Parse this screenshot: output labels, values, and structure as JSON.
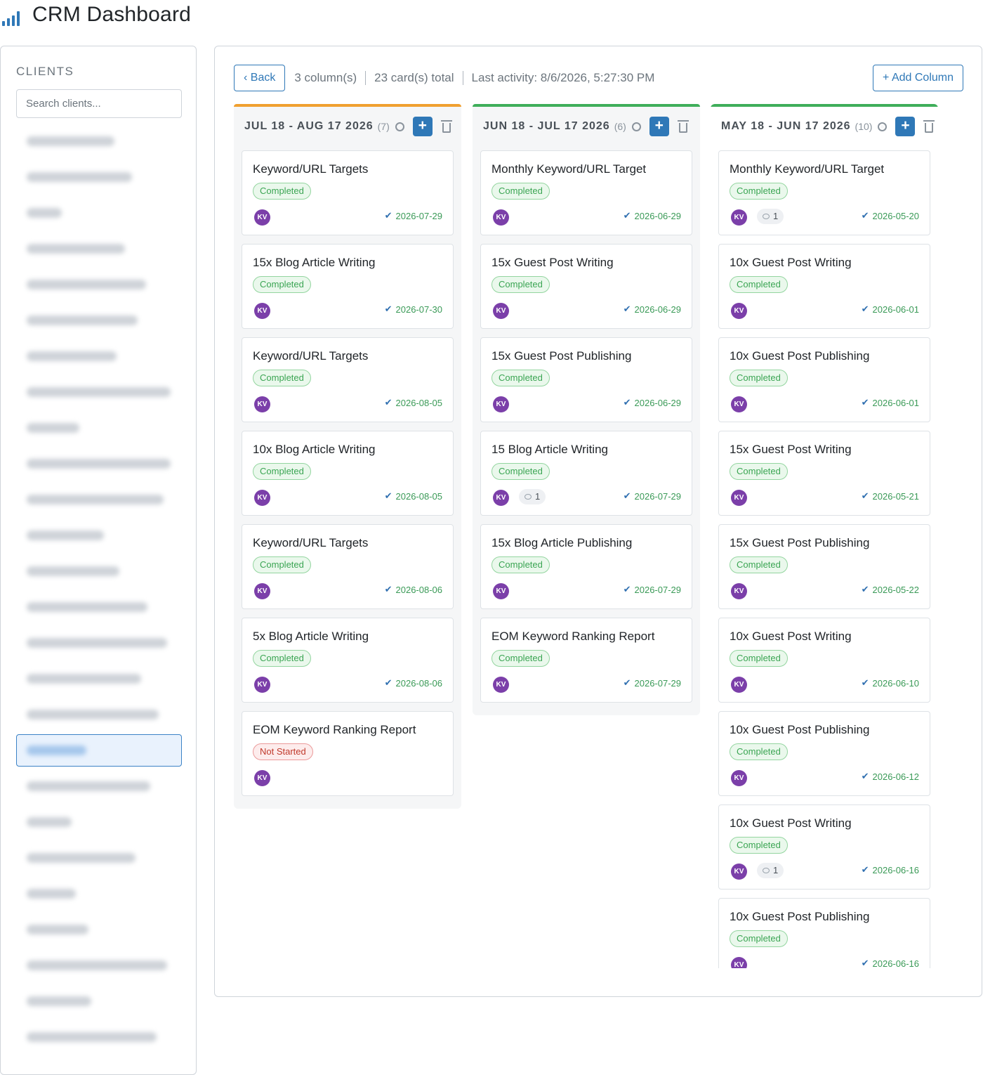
{
  "app": {
    "title": "CRM Dashboard",
    "logo_icon": "bar-chart-icon"
  },
  "sidebar": {
    "heading": "CLIENTS",
    "search_placeholder": "Search clients...",
    "clients": [
      {
        "w": 125
      },
      {
        "w": 150
      },
      {
        "w": 50
      },
      {
        "w": 140
      },
      {
        "w": 170
      },
      {
        "w": 158
      },
      {
        "w": 128
      },
      {
        "w": 205
      },
      {
        "w": 75
      },
      {
        "w": 205
      },
      {
        "w": 195
      },
      {
        "w": 110
      },
      {
        "w": 132
      },
      {
        "w": 172
      },
      {
        "w": 200
      },
      {
        "w": 163
      },
      {
        "w": 188
      },
      {
        "w": 85,
        "active": true
      },
      {
        "w": 176
      },
      {
        "w": 64
      },
      {
        "w": 155
      },
      {
        "w": 70
      },
      {
        "w": 88
      },
      {
        "w": 200
      },
      {
        "w": 92
      },
      {
        "w": 185
      }
    ]
  },
  "toolbar": {
    "back_label": "‹ Back",
    "column_count": "3 column(s)",
    "card_count": "23 card(s) total",
    "last_activity": "Last activity: 8/6/2026, 5:27:30 PM",
    "add_column_label": "+ Add Column"
  },
  "colors": {
    "accent": "#2f78b7",
    "orange": "#f0a030",
    "green": "#3fae5a",
    "avatar": "#7b3fa9"
  },
  "columns": [
    {
      "title": "JUL 18 - AUG 17 2026",
      "count": "(7)",
      "bar_color": "#f0a030",
      "cards": [
        {
          "title": "Keyword/URL Targets",
          "status": "Completed",
          "avatar": "KV",
          "date": "2026-07-29"
        },
        {
          "title": "15x Blog Article Writing",
          "status": "Completed",
          "avatar": "KV",
          "date": "2026-07-30"
        },
        {
          "title": "Keyword/URL Targets",
          "status": "Completed",
          "avatar": "KV",
          "date": "2026-08-05"
        },
        {
          "title": "10x Blog Article Writing",
          "status": "Completed",
          "avatar": "KV",
          "date": "2026-08-05"
        },
        {
          "title": "Keyword/URL Targets",
          "status": "Completed",
          "avatar": "KV",
          "date": "2026-08-06"
        },
        {
          "title": "5x Blog Article Writing",
          "status": "Completed",
          "avatar": "KV",
          "date": "2026-08-06"
        },
        {
          "title": "EOM Keyword Ranking Report",
          "status": "Not Started",
          "avatar": "KV",
          "date": ""
        }
      ]
    },
    {
      "title": "JUN 18 - JUL 17 2026",
      "count": "(6)",
      "bar_color": "#3fae5a",
      "cards": [
        {
          "title": "Monthly Keyword/URL Target",
          "status": "Completed",
          "avatar": "KV",
          "date": "2026-06-29"
        },
        {
          "title": "15x Guest Post Writing",
          "status": "Completed",
          "avatar": "KV",
          "date": "2026-06-29"
        },
        {
          "title": "15x Guest Post Publishing",
          "status": "Completed",
          "avatar": "KV",
          "date": "2026-06-29"
        },
        {
          "title": "15 Blog Article Writing",
          "status": "Completed",
          "avatar": "KV",
          "comments": "1",
          "date": "2026-07-29"
        },
        {
          "title": "15x Blog Article Publishing",
          "status": "Completed",
          "avatar": "KV",
          "date": "2026-07-29"
        },
        {
          "title": "EOM Keyword Ranking Report",
          "status": "Completed",
          "avatar": "KV",
          "date": "2026-07-29"
        }
      ]
    },
    {
      "title": "MAY 18 - JUN 17 2026",
      "count": "(10)",
      "bar_color": "#3fae5a",
      "cards": [
        {
          "title": "Monthly Keyword/URL Target",
          "status": "Completed",
          "avatar": "KV",
          "comments": "1",
          "date": "2026-05-20"
        },
        {
          "title": "10x Guest Post Writing",
          "status": "Completed",
          "avatar": "KV",
          "date": "2026-06-01"
        },
        {
          "title": "10x Guest Post Publishing",
          "status": "Completed",
          "avatar": "KV",
          "date": "2026-06-01"
        },
        {
          "title": "15x Guest Post Writing",
          "status": "Completed",
          "avatar": "KV",
          "date": "2026-05-21"
        },
        {
          "title": "15x Guest Post Publishing",
          "status": "Completed",
          "avatar": "KV",
          "date": "2026-05-22"
        },
        {
          "title": "10x Guest Post Writing",
          "status": "Completed",
          "avatar": "KV",
          "date": "2026-06-10"
        },
        {
          "title": "10x Guest Post Publishing",
          "status": "Completed",
          "avatar": "KV",
          "date": "2026-06-12"
        },
        {
          "title": "10x Guest Post Writing",
          "status": "Completed",
          "avatar": "KV",
          "comments": "1",
          "date": "2026-06-16"
        },
        {
          "title": "10x Guest Post Publishing",
          "status": "Completed",
          "avatar": "KV",
          "date": "2026-06-16"
        }
      ]
    }
  ]
}
